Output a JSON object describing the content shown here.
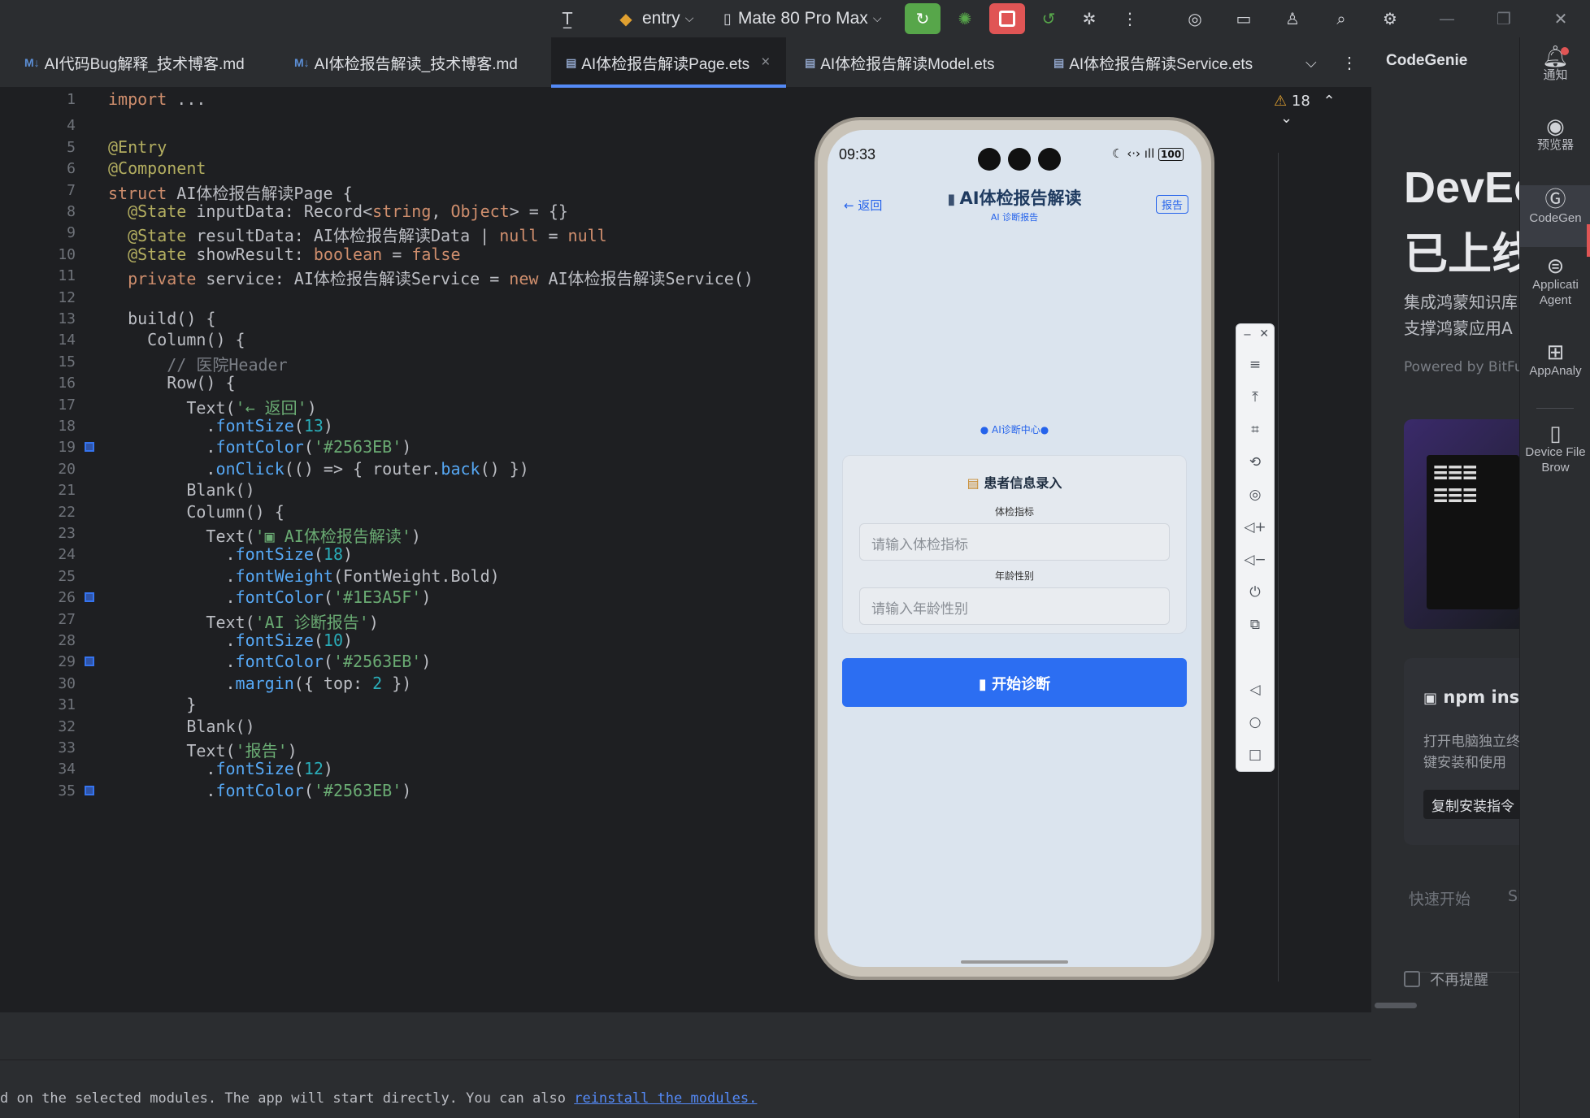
{
  "toolbar": {
    "module": "entry",
    "device": "Mate 80 Pro Max"
  },
  "tabs": [
    {
      "icon": "M↓",
      "label": "AI代码Bug解释_技术博客.md"
    },
    {
      "icon": "M↓",
      "label": "AI体检报告解读_技术博客.md"
    },
    {
      "icon": "ets",
      "label": "AI体检报告解读Page.ets",
      "close": "×"
    },
    {
      "icon": "ets",
      "label": "AI体检报告解读Model.ets"
    },
    {
      "icon": "ets",
      "label": "AI体检报告解读Service.ets"
    }
  ],
  "editor": {
    "warnings": "18"
  },
  "code_lines": [
    {
      "n": "1",
      "text": "import ..."
    },
    {
      "n": "4",
      "text": ""
    },
    {
      "n": "5",
      "text": "@Entry"
    },
    {
      "n": "6",
      "text": "@Component"
    },
    {
      "n": "7",
      "text": "struct AI体检报告解读Page {"
    },
    {
      "n": "8",
      "text": "  @State inputData: Record<string, Object> = {}"
    },
    {
      "n": "9",
      "text": "  @State resultData: AI体检报告解读Data | null = null"
    },
    {
      "n": "10",
      "text": "  @State showResult: boolean = false"
    },
    {
      "n": "11",
      "text": "  private service: AI体检报告解读Service = new AI体检报告解读Service()"
    },
    {
      "n": "12",
      "text": ""
    },
    {
      "n": "13",
      "text": "  build() {"
    },
    {
      "n": "14",
      "text": "    Column() {"
    },
    {
      "n": "15",
      "text": "      // 医院Header"
    },
    {
      "n": "16",
      "text": "      Row() {"
    },
    {
      "n": "17",
      "text": "        Text('← 返回')"
    },
    {
      "n": "18",
      "text": "          .fontSize(13)"
    },
    {
      "n": "19",
      "text": "          .fontColor('#2563EB')"
    },
    {
      "n": "20",
      "text": "          .onClick(() => { router.back() })"
    },
    {
      "n": "21",
      "text": "        Blank()"
    },
    {
      "n": "22",
      "text": "        Column() {"
    },
    {
      "n": "23",
      "text": "          Text('▣ AI体检报告解读')"
    },
    {
      "n": "24",
      "text": "            .fontSize(18)"
    },
    {
      "n": "25",
      "text": "            .fontWeight(FontWeight.Bold)"
    },
    {
      "n": "26",
      "text": "            .fontColor('#1E3A5F')"
    },
    {
      "n": "27",
      "text": "          Text('AI 诊断报告')"
    },
    {
      "n": "28",
      "text": "            .fontSize(10)"
    },
    {
      "n": "29",
      "text": "            .fontColor('#2563EB')"
    },
    {
      "n": "30",
      "text": "            .margin({ top: 2 })"
    },
    {
      "n": "31",
      "text": "        }"
    },
    {
      "n": "32",
      "text": "        Blank()"
    },
    {
      "n": "33",
      "text": "        Text('报告')"
    },
    {
      "n": "34",
      "text": "          .fontSize(12)"
    },
    {
      "n": "35",
      "text": "          .fontColor('#2563EB')"
    }
  ],
  "phone": {
    "time": "09:33",
    "battery": "100",
    "back": "← 返回",
    "title": "AI体检报告解读",
    "subtitle": "AI 诊断报告",
    "report_btn": "报告",
    "center_label": "● AI诊断中心●",
    "card_title": "患者信息录入",
    "field1_label": "体检指标",
    "field1_placeholder": "请输入体检指标",
    "field2_label": "年龄性别",
    "field2_placeholder": "请输入年龄性别",
    "submit": "开始诊断"
  },
  "codegenie": {
    "title": "CodeGenie",
    "hero1": "DevEc",
    "hero2": "已上线",
    "desc1": "集成鸿蒙知识库",
    "desc2": "支撑鸿蒙应用A",
    "powered": "Powered by BitFu",
    "npm_title": "npm ins",
    "npm_desc1": "打开电脑独立终",
    "npm_desc2": "键安装和使用",
    "copy_btn": "复制安装指令",
    "tab1": "快速开始",
    "tab2": "SI",
    "dont_remind": "不再提醒"
  },
  "strip": [
    {
      "label": "通知"
    },
    {
      "label": "预览器"
    },
    {
      "label": "CodeGen"
    },
    {
      "label": "Applicati Agent"
    },
    {
      "label": "AppAnaly"
    },
    {
      "label": "Device File Brow"
    }
  ],
  "bottom": {
    "status": "d on the selected modules. The app will start directly. You can also ",
    "link": "reinstall the modules."
  },
  "colors": {
    "accent": "#2563EB",
    "run": "#57a64a",
    "stop": "#e05555"
  }
}
